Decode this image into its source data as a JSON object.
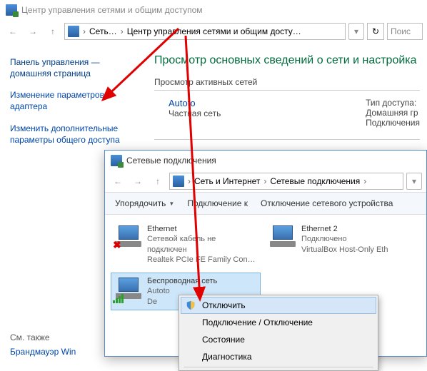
{
  "win1": {
    "title": "Центр управления сетями и общим доступом",
    "breadcrumb": {
      "p1": "Сеть…",
      "p2": "Центр управления сетями и общим досту…"
    },
    "search_placeholder": "Поис",
    "sidebar": {
      "home": "Панель управления — домашняя страница",
      "adapter": "Изменение параметров адаптера",
      "sharing": "Изменить дополнительные параметры общего доступа",
      "see_also": "См. также",
      "firewall": "Брандмауэр Win"
    },
    "main": {
      "big_title": "Просмотр основных сведений о сети и настройка",
      "active_nets": "Просмотр активных сетей",
      "net_name": "Autoto",
      "net_type": "Частная сеть",
      "col_access": "Тип доступа:",
      "col_homegroup": "Домашняя гр",
      "col_conn": "Подключения"
    }
  },
  "win2": {
    "title": "Сетевые подключения",
    "breadcrumb": {
      "p1": "Сеть и Интернет",
      "p2": "Сетевые подключения"
    },
    "toolbar": {
      "organize": "Упорядочить",
      "connect": "Подключение к",
      "disable": "Отключение сетевого устройства"
    },
    "conns": [
      {
        "name": "Ethernet",
        "status": "Сетевой кабель не подключен",
        "device": "Realtek PCIe FE Family Controller",
        "disabled": true
      },
      {
        "name": "Ethernet 2",
        "status": "Подключено",
        "device": "VirtualBox Host-Only Eth",
        "disabled": false
      },
      {
        "name": "Беспроводная сеть",
        "status": "Autoto",
        "device": "De",
        "wifi": true
      }
    ]
  },
  "ctx": {
    "disable": "Отключить",
    "connect": "Подключение / Отключение",
    "status": "Состояние",
    "diag": "Диагностика"
  }
}
